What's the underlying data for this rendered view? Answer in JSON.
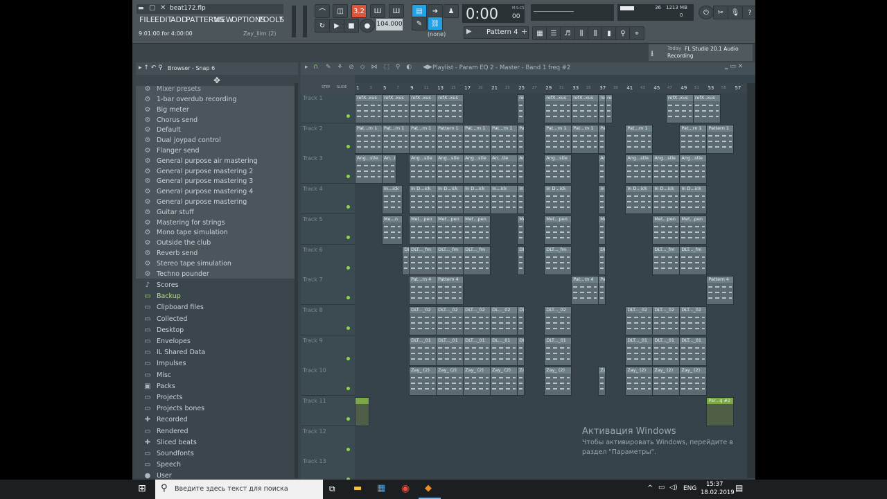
{
  "window": {
    "file_name": "beat172.flp",
    "time_info": "9:01:00 for 4:00:00",
    "artist": "Zay_llim (2)"
  },
  "menu": [
    "FILE",
    "EDIT",
    "ADD",
    "PATTERNS",
    "VIEW",
    "OPTIONS",
    "TOOLS",
    "?"
  ],
  "transport": {
    "tempo": "104.000",
    "time_display": "0:00",
    "time_suffix": "00",
    "time_label": "M:S:CS",
    "pattern": "Pattern 4",
    "snap_mode": "(none)",
    "step_value": "3.2",
    "cpu": "36",
    "memory": "1213 MB",
    "voices": "0"
  },
  "hint": {
    "today": "Today",
    "text": "FL Studio 20.1 Audio Recording"
  },
  "browser": {
    "title": "Browser - Snap 6",
    "section_header": "Mixer presets",
    "presets": [
      "1-bar overdub recording",
      "Big meter",
      "Chorus send",
      "Default",
      "Dual joypad control",
      "Flanger send",
      "General purpose air mastering",
      "General purpose mastering 2",
      "General purpose mastering 3",
      "General purpose mastering 4",
      "General purpose mastering",
      "Guitar stuff",
      "Mastering for strings",
      "Mono tape simulation",
      "Outside the club",
      "Reverb send",
      "Stereo tape simulation",
      "Techno pounder"
    ],
    "folders": [
      {
        "label": "Scores",
        "icon": "note-icon"
      },
      {
        "label": "Backup",
        "icon": "folder-icon",
        "highlight": true
      },
      {
        "label": "Clipboard files",
        "icon": "folder-icon"
      },
      {
        "label": "Collected",
        "icon": "folder-icon"
      },
      {
        "label": "Desktop",
        "icon": "folder-icon"
      },
      {
        "label": "Envelopes",
        "icon": "folder-icon"
      },
      {
        "label": "IL Shared Data",
        "icon": "folder-icon"
      },
      {
        "label": "Impulses",
        "icon": "folder-icon"
      },
      {
        "label": "Misc",
        "icon": "folder-icon"
      },
      {
        "label": "Packs",
        "icon": "packs-icon"
      },
      {
        "label": "Projects",
        "icon": "folder-icon"
      },
      {
        "label": "Projects bones",
        "icon": "folder-icon"
      },
      {
        "label": "Recorded",
        "icon": "plus-icon"
      },
      {
        "label": "Rendered",
        "icon": "folder-icon"
      },
      {
        "label": "Sliced beats",
        "icon": "plus-icon"
      },
      {
        "label": "Soundfonts",
        "icon": "folder-icon"
      },
      {
        "label": "Speech",
        "icon": "folder-icon"
      },
      {
        "label": "User",
        "icon": "user-icon"
      }
    ]
  },
  "playlist": {
    "title": "Playlist - Param EQ 2 - Master - Band 1 freq #2",
    "ruler_labels": [
      "STEP",
      "SLIDE"
    ],
    "bars": [
      "1",
      "5",
      "9",
      "13",
      "17",
      "21",
      "25",
      "29",
      "33",
      "37",
      "41",
      "45",
      "49",
      "53",
      "57"
    ],
    "sub_bars": [
      "3",
      "7",
      "11",
      "15",
      "19",
      "23",
      "27",
      "31",
      "35",
      "39",
      "43",
      "47",
      "51",
      "55"
    ],
    "tracks": [
      "Track 1",
      "Track 2",
      "Track 3",
      "Track 4",
      "Track 5",
      "Track 6",
      "Track 7",
      "Track 8",
      "Track 9",
      "Track 10",
      "Track 11",
      "Track 12",
      "Track 13"
    ],
    "clip_labels": {
      "t1": "refX..xus",
      "t2": "Pat...rn 1",
      "t2b": "Pattern 1",
      "t3": "Ang...stle",
      "t3b": "An...tle",
      "t4": "In D...ick",
      "t4b": "In...ick",
      "t5": "Met...pen",
      "t5b": "Me...n",
      "t6": "DLT..._fm",
      "t7": "Pat...rn 4",
      "t7b": "Pattern 4",
      "t8": "DLT..._02",
      "t8b": "DL..._02",
      "t9": "DLT..._01",
      "t9b": "DL..._01",
      "t10": "Zay_ (2)",
      "t11": "Par...q #2"
    }
  },
  "activation": {
    "title": "Активация Windows",
    "line1": "Чтобы активировать Windows, перейдите в",
    "line2": "раздел \"Параметры\"."
  },
  "taskbar": {
    "search_placeholder": "Введите здесь текст для поиска",
    "lang": "ENG",
    "time": "15:37",
    "date": "18.02.2019"
  },
  "colors": {
    "accent_green": "#8ed34a",
    "step_orange": "#e0543a",
    "highlight_cyan": "#21a2e6",
    "backup_green": "#b5e26c"
  }
}
